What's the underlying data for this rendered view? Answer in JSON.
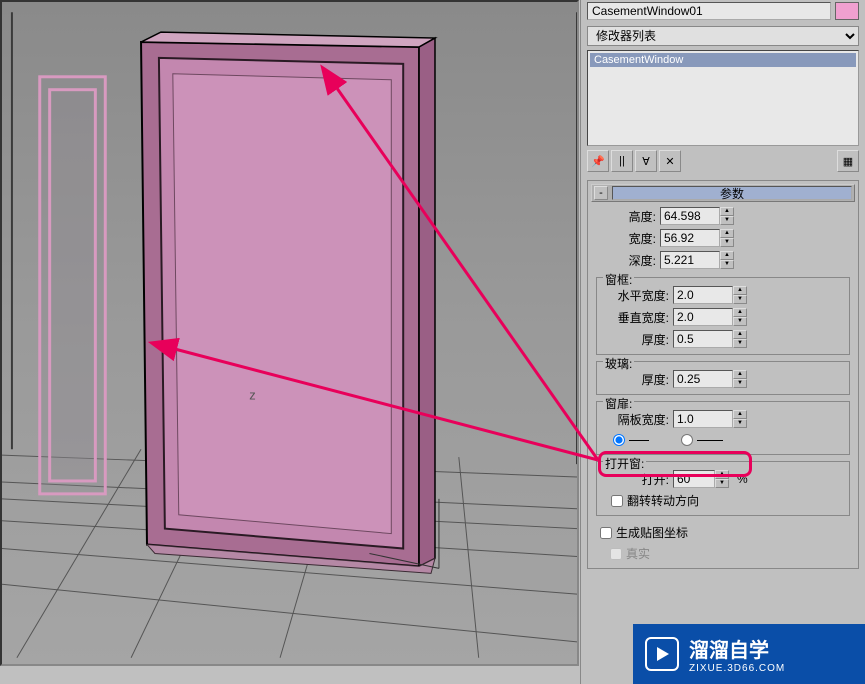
{
  "viewport": {
    "axis_label": "z"
  },
  "object_name": "CasementWindow01",
  "modifier_list_label": "修改器列表",
  "modifier_stack_item": "CasementWindow",
  "rollup": {
    "params_title": "参数"
  },
  "params": {
    "height_label": "高度:",
    "height_value": "64.598",
    "width_label": "宽度:",
    "width_value": "56.92",
    "depth_label": "深度:",
    "depth_value": "5.221"
  },
  "frame": {
    "group_label": "窗框:",
    "horiz_label": "水平宽度:",
    "horiz_value": "2.0",
    "vert_label": "垂直宽度:",
    "vert_value": "2.0",
    "thick_label": "厚度:",
    "thick_value": "0.5"
  },
  "glass": {
    "group_label": "玻璃:",
    "thick_label": "厚度:",
    "thick_value": "0.25"
  },
  "pane": {
    "group_label": "窗扉:",
    "sep_label": "隔板宽度:",
    "sep_value": "1.0"
  },
  "open_window": {
    "group_label": "打开窗:",
    "open_label": "打开:",
    "open_value": "60",
    "percent": "%",
    "flip_label": "翻转转动方向"
  },
  "gen_map_label": "生成贴图坐标",
  "real_label": "真实",
  "watermark": {
    "cn": "溜溜自学",
    "en": "ZIXUE.3D66.COM"
  }
}
